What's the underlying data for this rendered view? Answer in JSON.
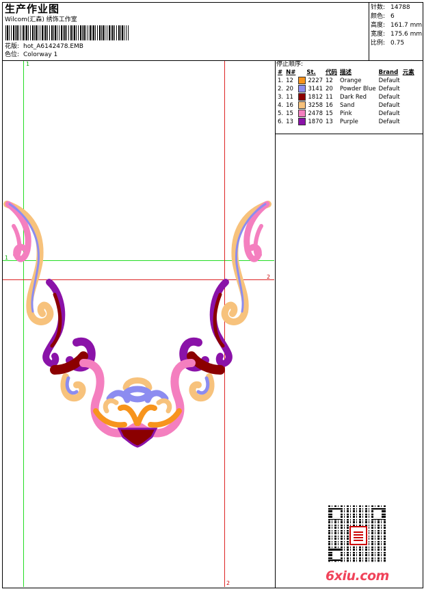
{
  "header": {
    "title": "生产作业图",
    "company": "Wilcom(汇森) 绣饰工作室",
    "design_label": "花版:",
    "design_file": "hot_A6142478.EMB",
    "colorway_label": "色位:",
    "colorway": "Colorway 1"
  },
  "stats": [
    {
      "label": "针数:",
      "value": "14788"
    },
    {
      "label": "颜色:",
      "value": "6"
    },
    {
      "label": "高度:",
      "value": "161.7 mm"
    },
    {
      "label": "宽度:",
      "value": "175.6 mm"
    },
    {
      "label": "比例:",
      "value": "0.75"
    }
  ],
  "thread_table": {
    "section_label": "停止顺序:",
    "columns": [
      "#",
      "N#",
      "St.",
      "代码",
      "描述",
      "Brand",
      "元素"
    ],
    "rows": [
      {
        "idx": "1.",
        "n": "12",
        "color": "#f7941d",
        "st": "2227",
        "code": "12",
        "desc": "Orange",
        "brand": "Default"
      },
      {
        "idx": "2.",
        "n": "20",
        "color": "#8c8cf0",
        "st": "3141",
        "code": "20",
        "desc": "Powder Blue",
        "brand": "Default"
      },
      {
        "idx": "3.",
        "n": "11",
        "color": "#8b0000",
        "st": "1812",
        "code": "11",
        "desc": "Dark Red",
        "brand": "Default"
      },
      {
        "idx": "4.",
        "n": "16",
        "color": "#f7c27c",
        "st": "3258",
        "code": "16",
        "desc": "Sand",
        "brand": "Default"
      },
      {
        "idx": "5.",
        "n": "15",
        "color": "#f47fbf",
        "st": "2478",
        "code": "15",
        "desc": "Pink",
        "brand": "Default"
      },
      {
        "idx": "6.",
        "n": "13",
        "color": "#8a12a8",
        "st": "1870",
        "code": "13",
        "desc": "Purple",
        "brand": "Default"
      }
    ]
  },
  "guides": {
    "v1": "1",
    "h1": "1",
    "h2": "2",
    "v2": "2"
  },
  "watermark": {
    "site": "6xiu.com"
  }
}
